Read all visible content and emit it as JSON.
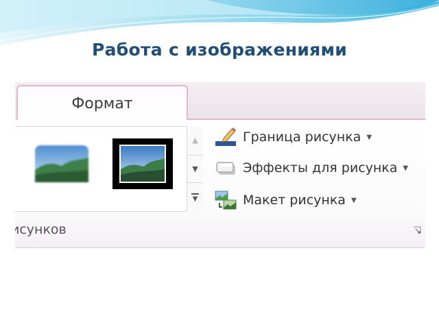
{
  "slide": {
    "title": "Работа с изображениями"
  },
  "ribbon": {
    "tab_label": "Формат",
    "group_label": "исунков",
    "commands": [
      {
        "label": "Граница рисунка",
        "icon": "picture-border-icon"
      },
      {
        "label": "Эффекты для рисунка",
        "icon": "picture-effects-icon"
      },
      {
        "label": "Макет рисунка",
        "icon": "picture-layout-icon"
      }
    ],
    "gallery": {
      "styles": [
        "soft-edge-style",
        "black-frame-style"
      ]
    }
  },
  "colors": {
    "title": "#1f4e79",
    "tab_border": "#e2b7ca",
    "wave_light": "#bfe8f6",
    "wave_dark": "#5cc6e6"
  }
}
